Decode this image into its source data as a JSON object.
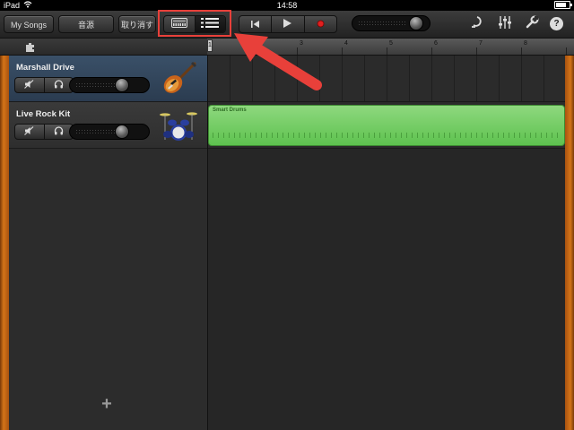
{
  "status_bar": {
    "device": "iPad",
    "time": "14:58",
    "battery_level": 0.8
  },
  "toolbar": {
    "my_songs_label": "My Songs",
    "instruments_label": "音源",
    "undo_label": "取り消す",
    "view_toggle": {
      "options": [
        "instrument-view-icon",
        "tracks-view-icon"
      ],
      "selected": "tracks-view-icon"
    },
    "transport": [
      "go-to-start-icon",
      "play-icon",
      "record-icon"
    ],
    "master_volume_level": 0.8,
    "right_icons": [
      "loop-icon",
      "mixer-settings-icon",
      "song-settings-icon",
      "help-icon"
    ],
    "help_glyph": "?"
  },
  "ruler": {
    "bars": [
      "1",
      "3",
      "4",
      "5",
      "6",
      "7",
      "8"
    ],
    "playhead_label": "1"
  },
  "tracks": [
    {
      "name": "Marshall Drive",
      "selected": true,
      "icon": "electric-guitar-icon",
      "volume_level": 0.75
    },
    {
      "name": "Live Rock Kit",
      "selected": false,
      "icon": "drum-kit-icon",
      "volume_level": 0.75
    }
  ],
  "regions": [
    {
      "track": "Live Rock Kit",
      "label": "Smart Drums",
      "color": "#6cc95c"
    }
  ],
  "add_track_glyph": "+",
  "annotation": {
    "highlight_color": "#e8403a"
  }
}
